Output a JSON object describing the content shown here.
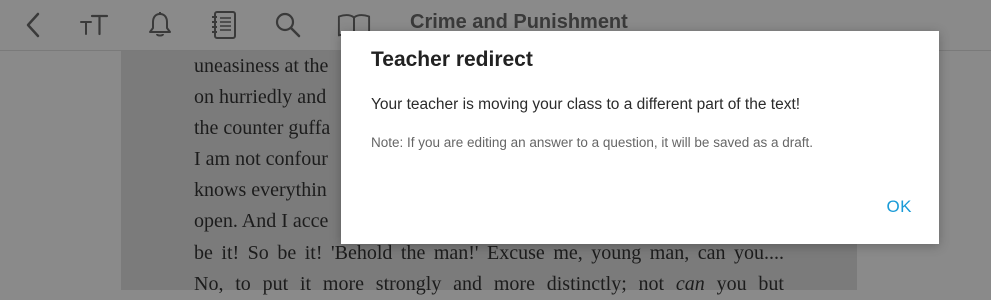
{
  "toolbar": {
    "icons": [
      "back-icon",
      "text-size-icon",
      "bell-icon",
      "notebook-icon",
      "search-icon",
      "book-icon"
    ],
    "book_title": "Crime and Punishment"
  },
  "page": {
    "lines": [
      "uneasiness at the",
      "on hurriedly and",
      "the counter guffa",
      "I am not confour",
      "knows everythin",
      "open. And I acce",
      "be it! So be it! 'Behold the man!' Excuse me, young man, can you....",
      "No, to put it more strongly and more distinctly; not can you but"
    ],
    "italic_word": "can"
  },
  "modal": {
    "title": "Teacher redirect",
    "message": "Your teacher is moving your class to a different part of the text!",
    "note": "Note: If you are editing an answer to a question, it will be saved as a draft.",
    "ok_label": "OK"
  },
  "colors": {
    "overlay_background": "#8a8a8a",
    "accent": "#1a9bd7"
  }
}
